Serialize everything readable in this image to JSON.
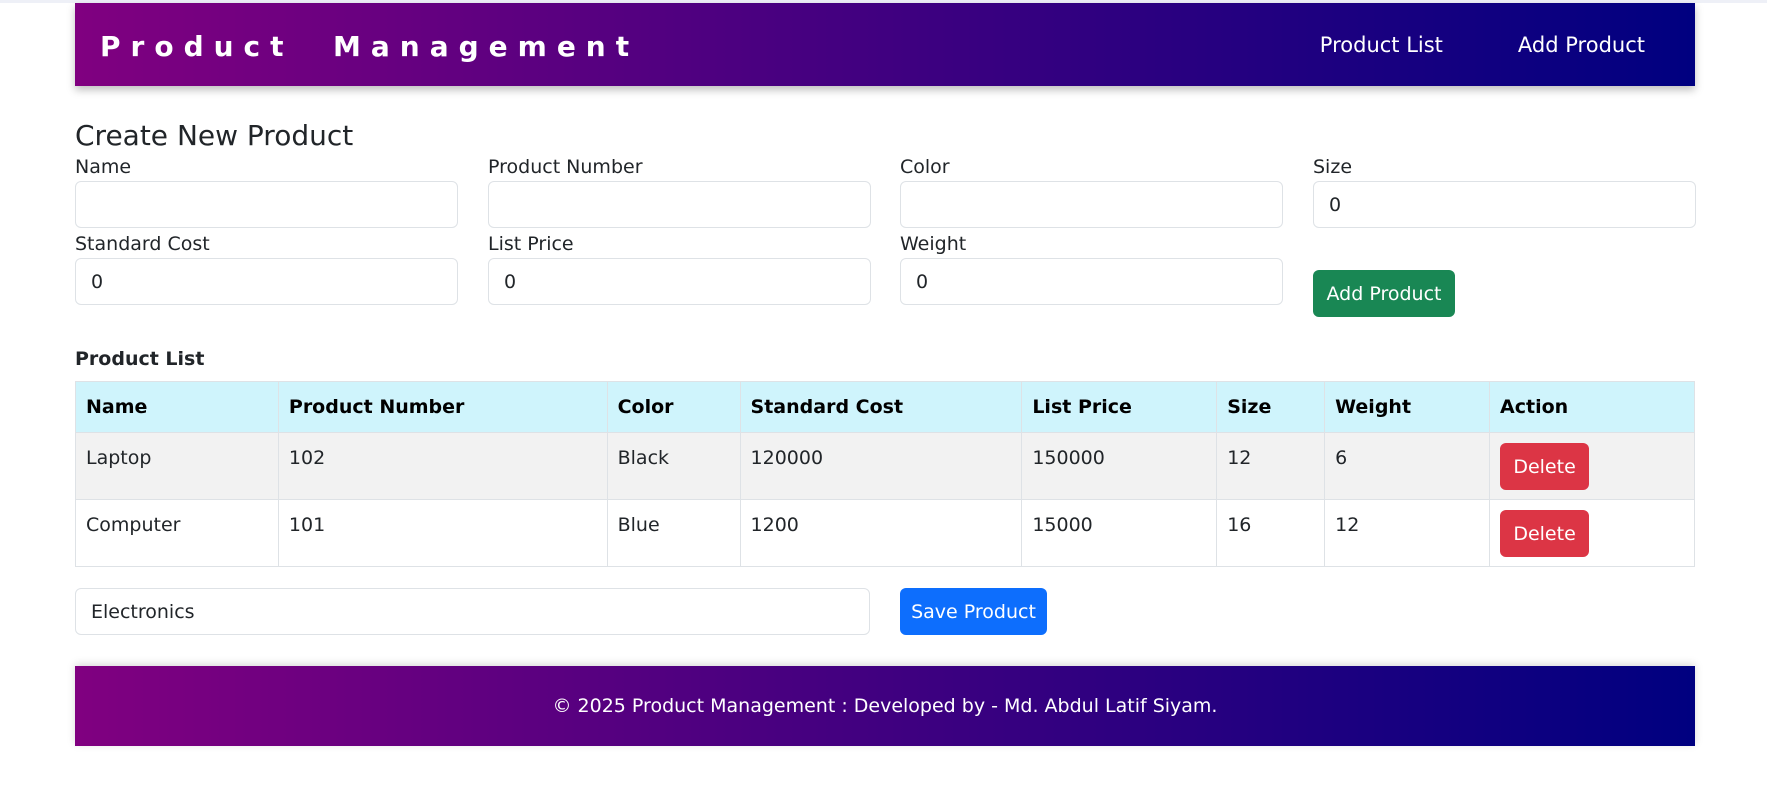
{
  "navbar": {
    "brand": "Product  Management",
    "links": [
      "Product List",
      "Add Product"
    ]
  },
  "form": {
    "title": "Create New Product",
    "fields": [
      {
        "label": "Name",
        "value": ""
      },
      {
        "label": "Product Number",
        "value": ""
      },
      {
        "label": "Color",
        "value": ""
      },
      {
        "label": "Size",
        "value": "0"
      },
      {
        "label": "Standard Cost",
        "value": "0"
      },
      {
        "label": "List Price",
        "value": "0"
      },
      {
        "label": "Weight",
        "value": "0"
      }
    ],
    "add_button": "Add Product"
  },
  "product_list": {
    "title": "Product List",
    "columns": [
      "Name",
      "Product Number",
      "Color",
      "Standard Cost",
      "List Price",
      "Size",
      "Weight",
      "Action"
    ],
    "rows": [
      [
        "Laptop",
        "102",
        "Black",
        "120000",
        "150000",
        "12",
        "6"
      ],
      [
        "Computer",
        "101",
        "Blue",
        "1200",
        "15000",
        "16",
        "12"
      ]
    ],
    "delete_label": "Delete"
  },
  "category": {
    "value": "Electronics",
    "save_button": "Save Product"
  },
  "footer": {
    "text": "© 2025 Product Management : Developed by - Md. Abdul Latif Siyam."
  },
  "colors": {
    "gradient_start": "#800080",
    "gradient_end": "#000080",
    "success": "#198754",
    "primary": "#0d6efd",
    "danger": "#dc3545",
    "table_header": "#cff4fc"
  }
}
